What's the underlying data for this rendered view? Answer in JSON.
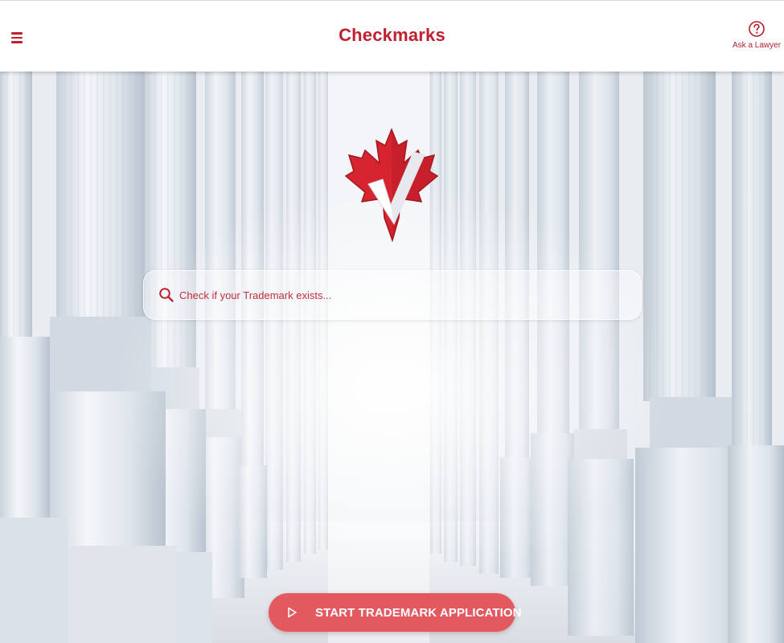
{
  "header": {
    "title": "Checkmarks",
    "menu_icon": "hamburger-menu-icon",
    "help": {
      "icon": "question-circle-icon",
      "label": "Ask a Lawyer"
    }
  },
  "hero": {
    "background": "white-columns-photo",
    "logo_icon": "maple-leaf-checkmark-logo"
  },
  "search": {
    "icon": "search-icon",
    "placeholder": "Check if your Trademark exists...",
    "value": ""
  },
  "cta": {
    "icon": "play-icon",
    "label": "START TRADEMARK APPLICATION"
  },
  "colors": {
    "brand": "#c0202f",
    "cta_background": "#e25a60",
    "header_background": "#ffffff"
  }
}
